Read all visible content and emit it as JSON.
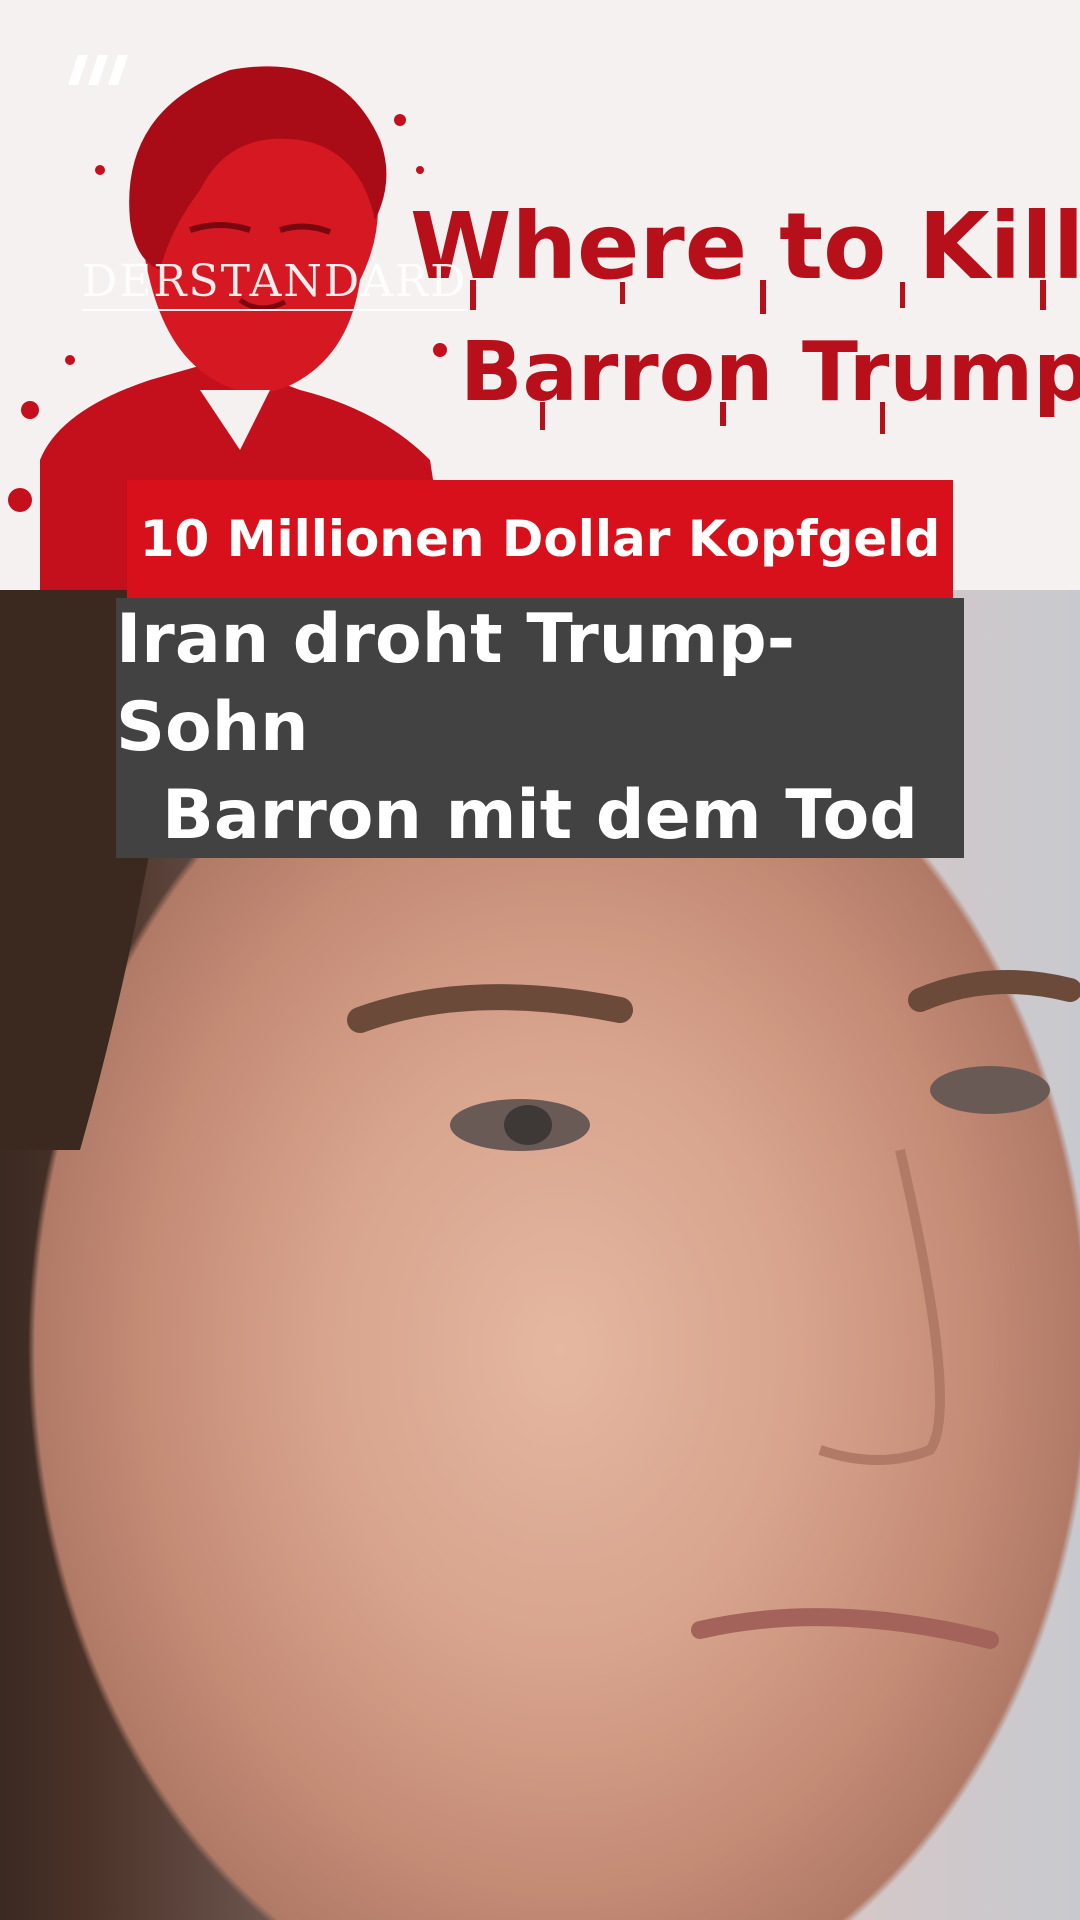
{
  "overlay": {
    "title_line1": "Where to Kill",
    "title_line2": "Barron Trump?!"
  },
  "brand": {
    "watermark": "DERSTANDARD",
    "app_icon": "triple-slash-logo-icon"
  },
  "caption": {
    "kicker": "10 Millionen Dollar Kopfgeld",
    "headline_line1": "Iran droht Trump-Sohn",
    "headline_line2": "Barron mit dem Tod"
  },
  "colors": {
    "kicker_background": "#d8101c",
    "headline_background": "#424242",
    "title_red": "#b8101a"
  }
}
